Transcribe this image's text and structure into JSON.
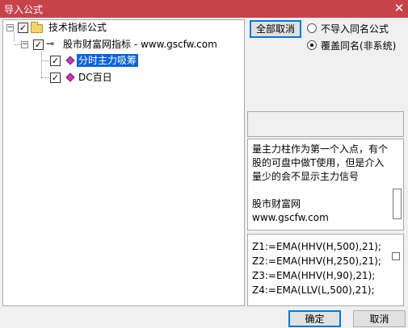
{
  "window": {
    "title": "导入公式",
    "close_glyph": "✕"
  },
  "tree": {
    "root": {
      "label": "技术指标公式",
      "checked": true
    },
    "group": {
      "label": "股市财富网指标 - www.gscfw.com",
      "checked": true
    },
    "items": [
      {
        "label": "分时主力吸筹",
        "checked": true,
        "selected": true
      },
      {
        "label": "DC百日",
        "checked": true,
        "selected": false
      }
    ]
  },
  "toolbar": {
    "cancel_all_label": "全部取消"
  },
  "import_options": {
    "selected": "overwrite",
    "options": [
      {
        "id": "skip",
        "label": "不导入同名公式"
      },
      {
        "id": "overwrite",
        "label": "覆盖同名(非系统)"
      }
    ]
  },
  "description": {
    "lines": [
      "量主力柱作为第一个入点，有个",
      "股的可盘中做T使用，但是介入",
      "量少的会不显示主力信号",
      "",
      "股市财富网",
      "www.gscfw.com"
    ]
  },
  "formula": {
    "lines": [
      "Z1:=EMA(HHV(H,500),21);",
      "Z2:=EMA(HHV(H,250),21);",
      "Z3:=EMA(HHV(H,90),21);",
      "Z4:=EMA(LLV(L,500),21);"
    ]
  },
  "footer": {
    "ok_label": "确定",
    "cancel_label": "取消"
  }
}
